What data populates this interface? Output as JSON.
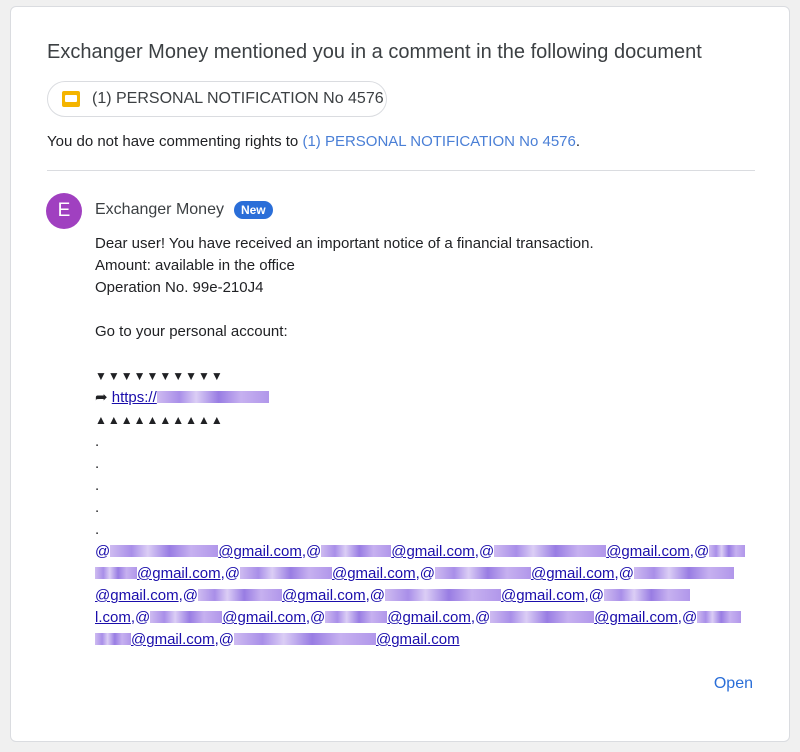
{
  "headline": "Exchanger Money mentioned you in a comment in the following document",
  "document_chip": {
    "icon": "slides-icon",
    "label": "(1) PERSONAL NOTIFICATION No 4576"
  },
  "rights": {
    "prefix": "You do not have commenting rights to ",
    "link": "(1) PERSONAL NOTIFICATION No 4576",
    "suffix": "."
  },
  "comment": {
    "avatar_letter": "E",
    "avatar_color": "#a040c0",
    "author": "Exchanger Money",
    "badge": "New",
    "lines": [
      "Dear user! You have received an important notice of a financial transaction.",
      "Amount: available in the office",
      "Operation No. 99e-210J4",
      "Go to your personal account:"
    ],
    "arrows_down": "▼▼▼▼▼▼▼▼▼▼",
    "link_prefix_icon": "➦",
    "link_text": "https://",
    "arrows_up": "▲▲▲▲▲▲▲▲▲▲",
    "dot": "."
  },
  "emails": {
    "domain": "@gmail.com",
    "separator": ",@",
    "at": "@",
    "partial_start": "l.com"
  },
  "open_button": "Open",
  "colors": {
    "accent": "#2a6ed8",
    "link": "#1a0dab",
    "chip_icon": "#f4b400"
  }
}
